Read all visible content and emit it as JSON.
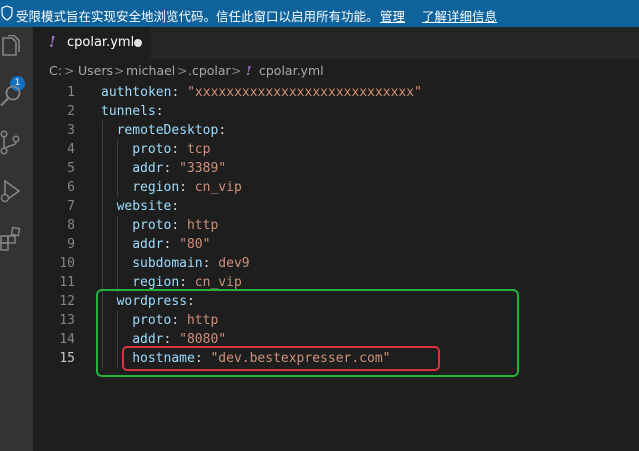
{
  "banner": {
    "message": "受限模式旨在实现安全地浏览代码。信任此窗口以启用所有功能。",
    "manage_link": "管理",
    "learn_more_link": "了解详细信息"
  },
  "activity_bar": {
    "source_control_badge": "1",
    "icons": [
      "explorer-icon",
      "search-icon",
      "source-control-icon",
      "run-debug-icon",
      "extensions-icon"
    ]
  },
  "tab": {
    "label": "cpolar.yml"
  },
  "breadcrumb": [
    "C:",
    "Users",
    "michael",
    ".cpolar",
    "cpolar.yml"
  ],
  "editor": {
    "active_line": 15,
    "lines": [
      {
        "n": "1",
        "indent": 0,
        "key": "authtoken",
        "value": "\"xxxxxxxxxxxxxxxxxxxxxxxxxxxx\"",
        "vtype": "s"
      },
      {
        "n": "2",
        "indent": 0,
        "key": "tunnels",
        "value": "",
        "vtype": "s"
      },
      {
        "n": "3",
        "indent": 1,
        "key": "remoteDesktop",
        "value": "",
        "vtype": "s"
      },
      {
        "n": "4",
        "indent": 2,
        "key": "proto",
        "value": "tcp",
        "vtype": "s"
      },
      {
        "n": "5",
        "indent": 2,
        "key": "addr",
        "value": "\"3389\"",
        "vtype": "s"
      },
      {
        "n": "6",
        "indent": 2,
        "key": "region",
        "value": "cn_vip",
        "vtype": "s"
      },
      {
        "n": "7",
        "indent": 1,
        "key": "website",
        "value": "",
        "vtype": "s"
      },
      {
        "n": "8",
        "indent": 2,
        "key": "proto",
        "value": "http",
        "vtype": "s"
      },
      {
        "n": "9",
        "indent": 2,
        "key": "addr",
        "value": "\"80\"",
        "vtype": "s"
      },
      {
        "n": "10",
        "indent": 2,
        "key": "subdomain",
        "value": "dev9",
        "vtype": "s"
      },
      {
        "n": "11",
        "indent": 2,
        "key": "region",
        "value": "cn_vip",
        "vtype": "s"
      },
      {
        "n": "12",
        "indent": 1,
        "key": "wordpress",
        "value": "",
        "vtype": "s"
      },
      {
        "n": "13",
        "indent": 2,
        "key": "proto",
        "value": "http",
        "vtype": "s"
      },
      {
        "n": "14",
        "indent": 2,
        "key": "addr",
        "value": "\"8080\"",
        "vtype": "s"
      },
      {
        "n": "15",
        "indent": 2,
        "key": "hostname",
        "value": "\"dev.bestexpresser.com\"",
        "vtype": "s"
      }
    ]
  },
  "colors": {
    "banner": "#0e639c",
    "editor_bg": "#1e1e1e",
    "key": "#9cdcfe",
    "string": "#ce9178",
    "highlight_green": "#27b13f",
    "highlight_red": "#e0323c"
  }
}
